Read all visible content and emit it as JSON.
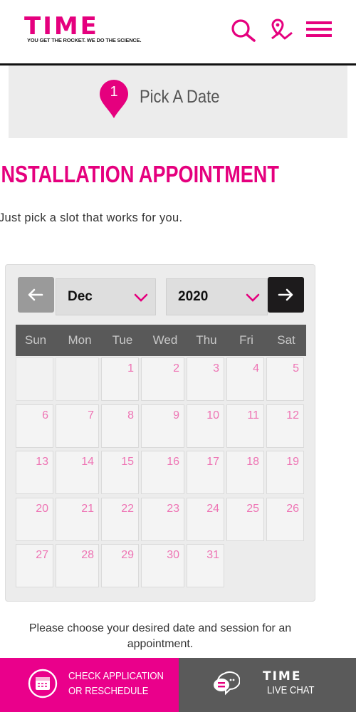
{
  "header": {
    "logo_text": "TIME",
    "tagline": "YOU GET THE ROCKET. WE DO THE SCIENCE.",
    "accent_color": "#e5007e"
  },
  "step": {
    "number": "1",
    "label": "Pick A Date"
  },
  "page": {
    "title": "INSTALLATION APPOINTMENT",
    "subtitle": "Just pick a slot that works for you."
  },
  "calendar": {
    "month": "Dec",
    "year": "2020",
    "weekdays": [
      "Sun",
      "Mon",
      "Tue",
      "Wed",
      "Thu",
      "Fri",
      "Sat"
    ],
    "weeks": [
      [
        "",
        "",
        "1",
        "2",
        "3",
        "4",
        "5"
      ],
      [
        "6",
        "7",
        "8",
        "9",
        "10",
        "11",
        "12"
      ],
      [
        "13",
        "14",
        "15",
        "16",
        "17",
        "18",
        "19"
      ],
      [
        "20",
        "21",
        "22",
        "23",
        "24",
        "25",
        "26"
      ],
      [
        "27",
        "28",
        "29",
        "30",
        "31",
        "",
        ""
      ]
    ]
  },
  "note": "Please choose your desired date and session for an appointment.",
  "bottom": {
    "check_line1": "CHECK APPLICATION",
    "check_line2": "OR RESCHEDULE",
    "chat_logo": "TIME",
    "chat_label": "LIVE CHAT"
  }
}
